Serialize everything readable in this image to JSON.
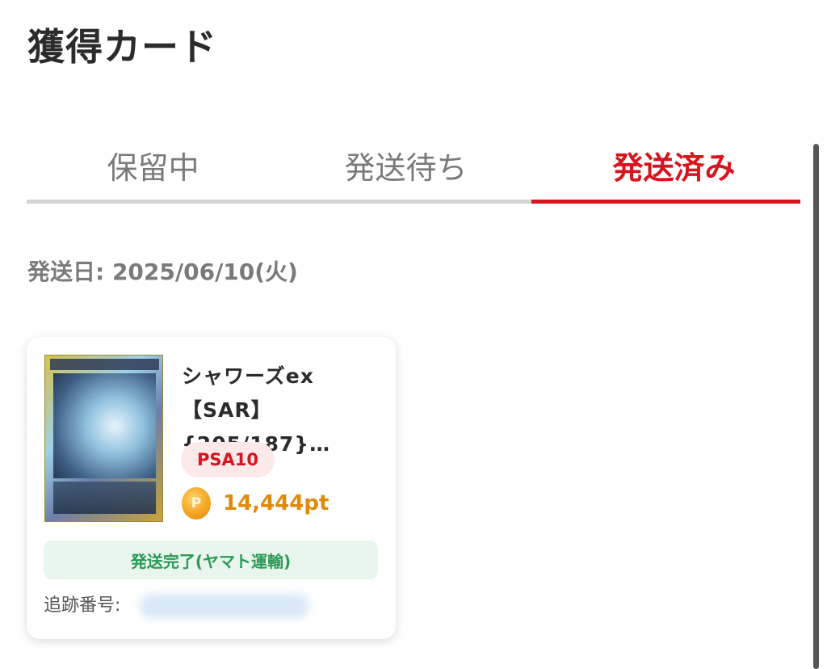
{
  "header": {
    "title": "獲得カード"
  },
  "tabs": [
    {
      "label": "保留中",
      "active": false
    },
    {
      "label": "発送待ち",
      "active": false
    },
    {
      "label": "発送済み",
      "active": true
    }
  ],
  "shipment": {
    "date_label": "発送日: 2025/06/10(火)",
    "card": {
      "name": "シャワーズex【SAR】{205/187}…",
      "grade": "PSA10",
      "points": "14,444pt",
      "coin_icon": "coin-icon",
      "coin_letter": "P",
      "status": "発送完了(ヤマト運輸)",
      "tracking_label": "追跡番号:",
      "tracking_number": ""
    }
  },
  "colors": {
    "accent": "#d8141e",
    "points": "#e08a0b",
    "status_green": "#2a9a55",
    "status_bg": "#e9f6ee",
    "badge_bg": "#fde8ea"
  }
}
